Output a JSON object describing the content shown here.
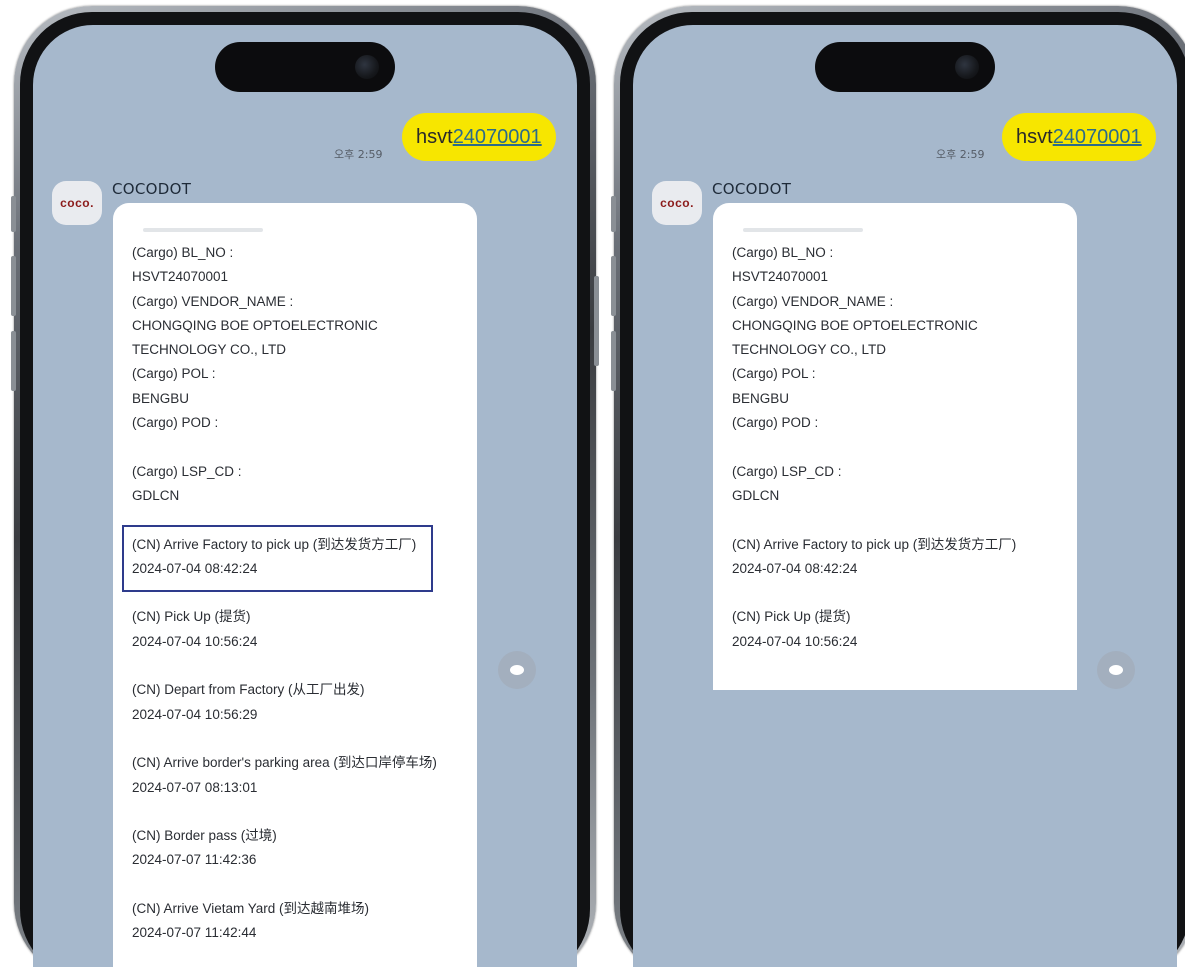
{
  "chat": {
    "sent_time": "오후 2:59",
    "sent_prefix": "hsvt",
    "sent_number": "24070001",
    "sender_name": "COCODOT",
    "avatar_text": "coco."
  },
  "fields": [
    {
      "label": "(Cargo) BL_NO :",
      "value": "HSVT24070001"
    },
    {
      "label": "(Cargo) VENDOR_NAME :",
      "value": "CHONGQING BOE OPTOELECTRONIC",
      "value2": "TECHNOLOGY CO., LTD"
    },
    {
      "label": "(Cargo) POL :",
      "value": "BENGBU"
    },
    {
      "label": "(Cargo) POD :",
      "value": ""
    },
    {
      "label": "(Cargo) LSP_CD :",
      "value": "GDLCN"
    }
  ],
  "events": [
    {
      "name": "(CN) Arrive Factory to pick up (到达发货方工厂)",
      "time": "2024-07-04 08:42:24"
    },
    {
      "name": "(CN) Pick Up (提货)",
      "time": "2024-07-04 10:56:24"
    },
    {
      "name": "(CN) Depart from Factory (从工厂出发)",
      "time": "2024-07-04 10:56:29"
    },
    {
      "name": "(CN) Arrive border's parking area (到达口岸停车场)",
      "time": "2024-07-07 08:13:01"
    },
    {
      "name": "(CN) Border pass (过境)",
      "time": "2024-07-07 11:42:36"
    },
    {
      "name": "(CN) Arrive Vietam Yard (到达越南堆场)",
      "time": "2024-07-07 11:42:44"
    }
  ],
  "colors": {
    "chat_background": "#a6b8cc",
    "my_bubble": "#f7e600",
    "highlight_box": "#2e3b8c"
  },
  "icons": [
    "speech-bubble-icon",
    "camera-icon"
  ]
}
